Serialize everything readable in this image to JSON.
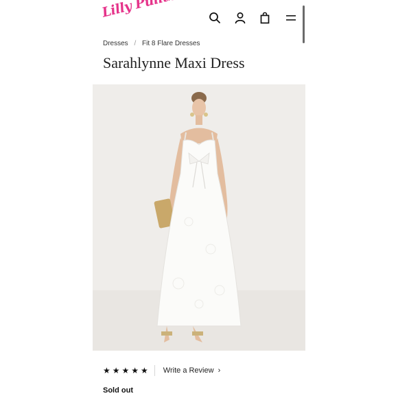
{
  "brand": {
    "logo_text": "Lilly Pulitzer",
    "color": "#e5338a"
  },
  "header": {
    "icons": [
      "search-icon",
      "account-icon",
      "bag-icon",
      "menu-icon"
    ]
  },
  "breadcrumb": {
    "items": [
      "Dresses",
      "Fit 8 Flare Dresses"
    ],
    "separator": "/"
  },
  "product": {
    "title": "Sarahlynne Maxi Dress",
    "rating_stars": "★★★★★",
    "rating_value": 5,
    "review_link": "Write a Review",
    "review_chevron": "›",
    "status": "Sold out"
  }
}
